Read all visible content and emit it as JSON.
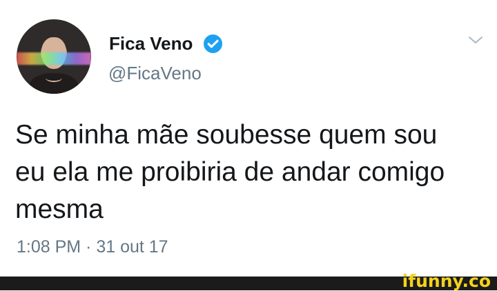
{
  "tweet": {
    "author": {
      "display_name": "Fica Veno",
      "username": "@FicaVeno",
      "avatar_icon": "profile-photo"
    },
    "text": "Se minha mãe soubesse quem sou eu ela me proibiria de andar comigo mesma",
    "timestamp": "1:08 PM · 31 out 17",
    "verified": true,
    "menu_icon": "chevron-down-icon"
  },
  "watermark": {
    "text": "ifunny.co",
    "color": "#f4d21b"
  },
  "colors": {
    "background": "#ffffff",
    "primary_text": "#14171a",
    "secondary_text": "#657786",
    "verified_blue": "#1da1f2",
    "footer": "#1b1b1b"
  }
}
